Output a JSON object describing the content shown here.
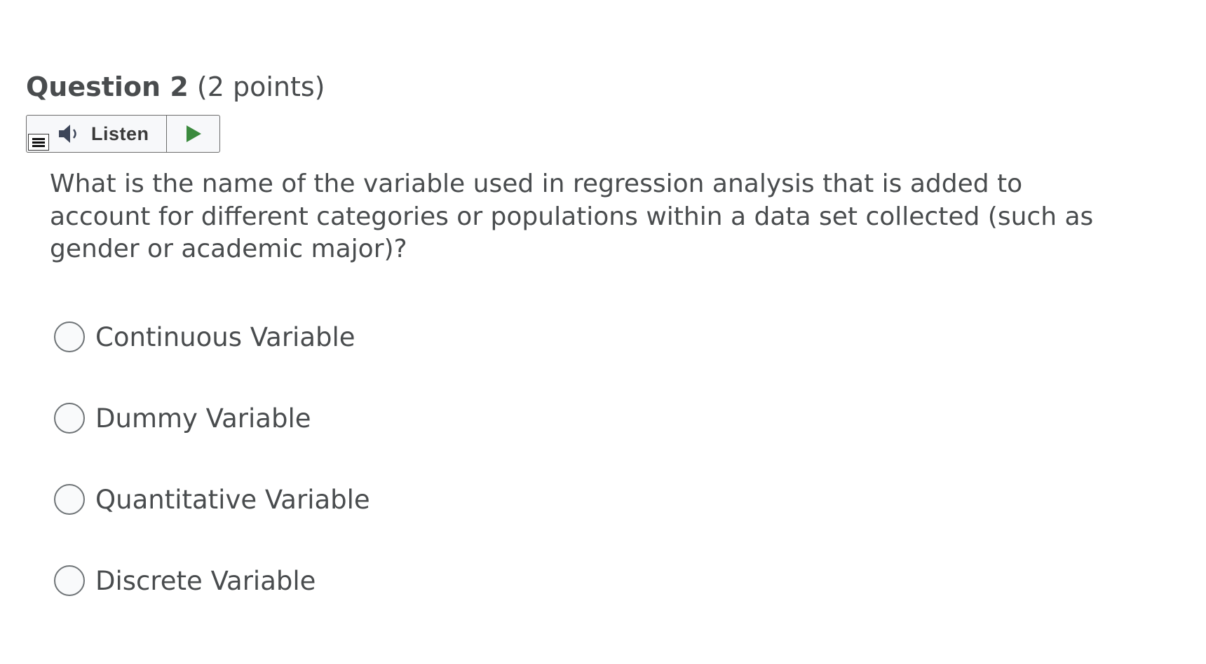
{
  "question": {
    "title": "Question 2",
    "points": "(2 points)",
    "text": "What is the name of the variable used in regression analysis that is added to account for different categories or populations within a data set collected (such as gender or academic major)?"
  },
  "listen": {
    "label": "Listen",
    "speaker_icon": "speaker-icon",
    "play_icon": "play-icon",
    "menu_icon": "menu-icon",
    "play_color": "#3b8a3e"
  },
  "options": [
    {
      "label": "Continuous Variable",
      "selected": false
    },
    {
      "label": "Dummy Variable",
      "selected": false
    },
    {
      "label": "Quantitative Variable",
      "selected": false
    },
    {
      "label": "Discrete Variable",
      "selected": false
    }
  ]
}
